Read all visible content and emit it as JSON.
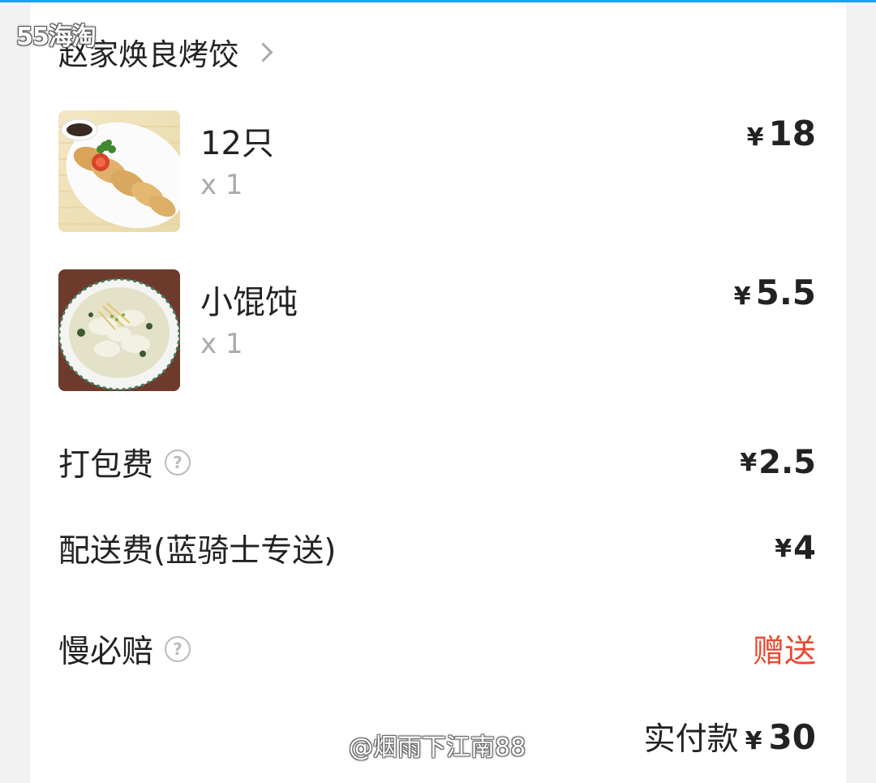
{
  "watermark_top": "55海淘",
  "store": {
    "name": "赵家焕良烤饺"
  },
  "items": [
    {
      "name": "12只",
      "qty": "x 1",
      "currency": "¥",
      "price": "18",
      "image": "fried-dumplings-photo"
    },
    {
      "name": "小馄饨",
      "qty": "x 1",
      "currency": "¥",
      "price": "5.5",
      "image": "wonton-soup-photo"
    }
  ],
  "fees": {
    "packaging": {
      "label": "打包费",
      "currency": "¥",
      "value": "2.5",
      "help_icon": "question-circle-icon"
    },
    "delivery": {
      "label": "配送费(蓝骑士专送)",
      "currency": "¥",
      "value": "4"
    },
    "late_guarantee": {
      "label": "慢必赔",
      "value": "赠送",
      "help_icon": "question-circle-icon"
    }
  },
  "total": {
    "label": "实付款",
    "currency": "¥",
    "value": "30"
  },
  "watermark_bottom": "@烟雨下江南88",
  "colors": {
    "accent_top_line": "#1aa3f0",
    "free_red": "#e8492d",
    "muted": "#aaaaaa"
  }
}
